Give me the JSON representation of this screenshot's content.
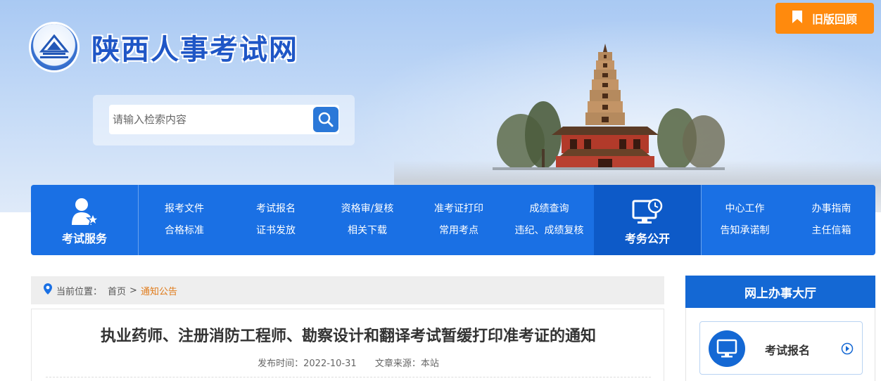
{
  "header": {
    "site_title": "陕西人事考试网",
    "old_version_label": "旧版回顾",
    "search": {
      "placeholder": "请输入检索内容"
    }
  },
  "nav": {
    "exam_service": {
      "label": "考试服务",
      "icon": "person-star-icon"
    },
    "exam_public": {
      "label": "考务公开",
      "icon": "monitor-clock-icon"
    },
    "links_group1": [
      "报考文件",
      "考试报名",
      "资格审/复核",
      "准考证打印",
      "成绩查询",
      "合格标准",
      "证书发放",
      "相关下载",
      "常用考点",
      "违纪、成绩复核"
    ],
    "links_group2": [
      "中心工作",
      "办事指南",
      "告知承诺制",
      "主任信箱"
    ]
  },
  "breadcrumb": {
    "prefix": "当前位置：",
    "home": "首页",
    "separator": ">",
    "current": "通知公告"
  },
  "article": {
    "title": "执业药师、注册消防工程师、勘察设计和翻译考试暂缓打印准考证的通知",
    "publish_label": "发布时间：",
    "publish_date": "2022-10-31",
    "source_label": "文章来源：",
    "source": "本站"
  },
  "sidebar": {
    "header": "网上办事大厅",
    "card_label": "考试报名"
  },
  "colors": {
    "primary_blue": "#1a70e4",
    "orange": "#ff8a0d",
    "breadcrumb_current": "#e07b1a"
  }
}
